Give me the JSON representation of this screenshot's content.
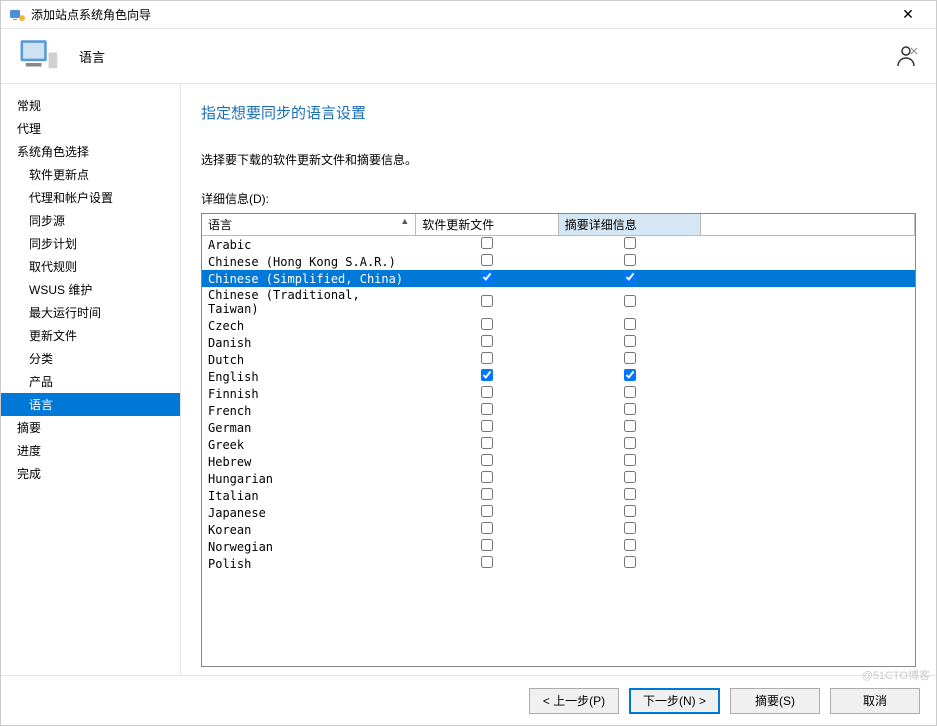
{
  "titlebar": {
    "text": "添加站点系统角色向导"
  },
  "header": {
    "title": "语言"
  },
  "sidebar": {
    "items": [
      {
        "label": "常规",
        "indent": false,
        "active": false
      },
      {
        "label": "代理",
        "indent": false,
        "active": false
      },
      {
        "label": "系统角色选择",
        "indent": false,
        "active": false
      },
      {
        "label": "软件更新点",
        "indent": true,
        "active": false
      },
      {
        "label": "代理和帐户设置",
        "indent": true,
        "active": false
      },
      {
        "label": "同步源",
        "indent": true,
        "active": false
      },
      {
        "label": "同步计划",
        "indent": true,
        "active": false
      },
      {
        "label": "取代规则",
        "indent": true,
        "active": false
      },
      {
        "label": "WSUS 维护",
        "indent": true,
        "active": false
      },
      {
        "label": "最大运行时间",
        "indent": true,
        "active": false
      },
      {
        "label": "更新文件",
        "indent": true,
        "active": false
      },
      {
        "label": "分类",
        "indent": true,
        "active": false
      },
      {
        "label": "产品",
        "indent": true,
        "active": false
      },
      {
        "label": "语言",
        "indent": true,
        "active": true
      },
      {
        "label": "摘要",
        "indent": false,
        "active": false
      },
      {
        "label": "进度",
        "indent": false,
        "active": false
      },
      {
        "label": "完成",
        "indent": false,
        "active": false
      }
    ]
  },
  "content": {
    "heading": "指定想要同步的语言设置",
    "instruction": "选择要下载的软件更新文件和摘要信息。",
    "detail_label": "详细信息(D):"
  },
  "table": {
    "columns": {
      "lang": "语言",
      "files": "软件更新文件",
      "summary": "摘要详细信息"
    },
    "rows": [
      {
        "lang": "Arabic",
        "files": false,
        "summary": false,
        "selected": false
      },
      {
        "lang": "Chinese (Hong Kong S.A.R.)",
        "files": false,
        "summary": false,
        "selected": false
      },
      {
        "lang": "Chinese (Simplified, China)",
        "files": true,
        "summary": true,
        "selected": true
      },
      {
        "lang": "Chinese (Traditional, Taiwan)",
        "files": false,
        "summary": false,
        "selected": false
      },
      {
        "lang": "Czech",
        "files": false,
        "summary": false,
        "selected": false
      },
      {
        "lang": "Danish",
        "files": false,
        "summary": false,
        "selected": false
      },
      {
        "lang": "Dutch",
        "files": false,
        "summary": false,
        "selected": false
      },
      {
        "lang": "English",
        "files": true,
        "summary": true,
        "selected": false
      },
      {
        "lang": "Finnish",
        "files": false,
        "summary": false,
        "selected": false
      },
      {
        "lang": "French",
        "files": false,
        "summary": false,
        "selected": false
      },
      {
        "lang": "German",
        "files": false,
        "summary": false,
        "selected": false
      },
      {
        "lang": "Greek",
        "files": false,
        "summary": false,
        "selected": false
      },
      {
        "lang": "Hebrew",
        "files": false,
        "summary": false,
        "selected": false
      },
      {
        "lang": "Hungarian",
        "files": false,
        "summary": false,
        "selected": false
      },
      {
        "lang": "Italian",
        "files": false,
        "summary": false,
        "selected": false
      },
      {
        "lang": "Japanese",
        "files": false,
        "summary": false,
        "selected": false
      },
      {
        "lang": "Korean",
        "files": false,
        "summary": false,
        "selected": false
      },
      {
        "lang": "Norwegian",
        "files": false,
        "summary": false,
        "selected": false
      },
      {
        "lang": "Polish",
        "files": false,
        "summary": false,
        "selected": false
      }
    ]
  },
  "footer": {
    "prev": "< 上一步(P)",
    "next": "下一步(N) >",
    "summary": "摘要(S)",
    "cancel": "取消"
  },
  "watermark": "@51CTO博客"
}
